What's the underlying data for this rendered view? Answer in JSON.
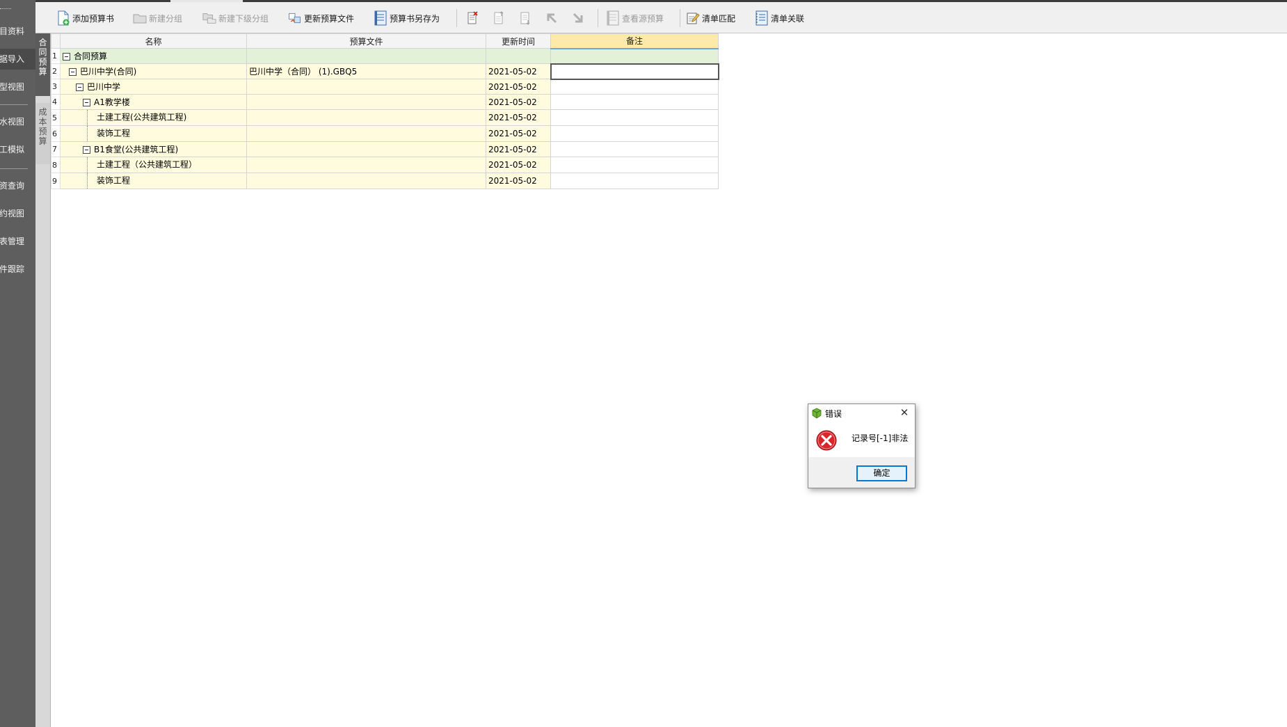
{
  "sidebar": {
    "items": [
      {
        "label": "项目资料"
      },
      {
        "label": "数据导入"
      },
      {
        "label": "模型视图"
      },
      {
        "label": "流水视图"
      },
      {
        "label": "施工模拟"
      },
      {
        "label": "物资查询"
      },
      {
        "label": "合约视图"
      },
      {
        "label": "报表管理"
      },
      {
        "label": "构件跟踪"
      }
    ]
  },
  "vtabs": {
    "contract": "合同预算",
    "cost": "成本预算"
  },
  "toolbar": {
    "add_budget": "添加预算书",
    "new_group": "新建分组",
    "new_subgroup": "新建下级分组",
    "update_budget_file": "更新预算文件",
    "save_budget_as": "预算书另存为",
    "view_source_budget": "查看源预算",
    "list_match": "清单匹配",
    "list_link": "清单关联"
  },
  "grid": {
    "headers": {
      "name": "名称",
      "budget_file": "预算文件",
      "update_time": "更新时间",
      "note": "备注"
    },
    "rows": [
      {
        "num": "1",
        "name": "合同预算",
        "file": "",
        "time": "",
        "note": ""
      },
      {
        "num": "2",
        "name": "巴川中学(合同)",
        "file": "巴川中学（合同） (1).GBQ5",
        "time": "2021-05-02",
        "note": ""
      },
      {
        "num": "3",
        "name": "巴川中学",
        "file": "",
        "time": "2021-05-02",
        "note": ""
      },
      {
        "num": "4",
        "name": "A1教学楼",
        "file": "",
        "time": "2021-05-02",
        "note": ""
      },
      {
        "num": "5",
        "name": "土建工程(公共建筑工程)",
        "file": "",
        "time": "2021-05-02",
        "note": ""
      },
      {
        "num": "6",
        "name": "装饰工程",
        "file": "",
        "time": "2021-05-02",
        "note": ""
      },
      {
        "num": "7",
        "name": "B1食堂(公共建筑工程)",
        "file": "",
        "time": "2021-05-02",
        "note": ""
      },
      {
        "num": "8",
        "name": "土建工程（公共建筑工程）",
        "file": "",
        "time": "2021-05-02",
        "note": ""
      },
      {
        "num": "9",
        "name": "装饰工程",
        "file": "",
        "time": "2021-05-02",
        "note": ""
      }
    ]
  },
  "dialog": {
    "title": "错误",
    "message": "记录号[-1]非法",
    "ok": "确定",
    "close": "✕"
  }
}
